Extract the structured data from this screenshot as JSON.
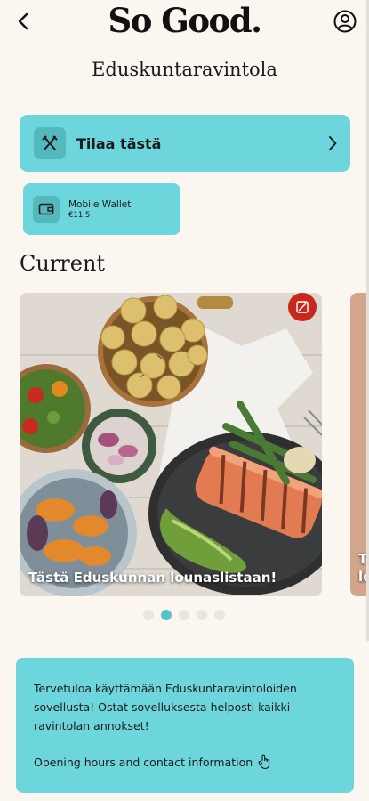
{
  "header": {
    "logo": "So Good.",
    "back_icon": "chevron-left-icon",
    "profile_icon": "user-circle-icon"
  },
  "restaurant": {
    "name": "Eduskuntaravintola"
  },
  "order_card": {
    "label": "Tilaa tästä",
    "icon": "utensils-icon",
    "chevron": "chevron-right-icon"
  },
  "wallet": {
    "title": "Mobile Wallet",
    "balance": "€11.5",
    "icon": "wallet-icon"
  },
  "section": {
    "title": "Current"
  },
  "carousel": {
    "slides": [
      {
        "caption": "Tästä Eduskunnan lounaslistaan!"
      },
      {
        "caption_line1": "T",
        "caption_line2": "lo"
      }
    ],
    "dot_count": 5,
    "active_index": 1
  },
  "info": {
    "text": "Tervetuloa käyttämään Eduskuntaravintoloiden sovellusta! Ostat sovelluksesta helposti kaikki ravintolan annokset!",
    "link": "Opening hours and contact information",
    "link_icon": "hand-pointer-icon"
  },
  "colors": {
    "background": "#fcf6f0",
    "accent": "#6cd6dc",
    "accent_dark": "#53b9bf",
    "dot_active": "#56c3cb"
  }
}
